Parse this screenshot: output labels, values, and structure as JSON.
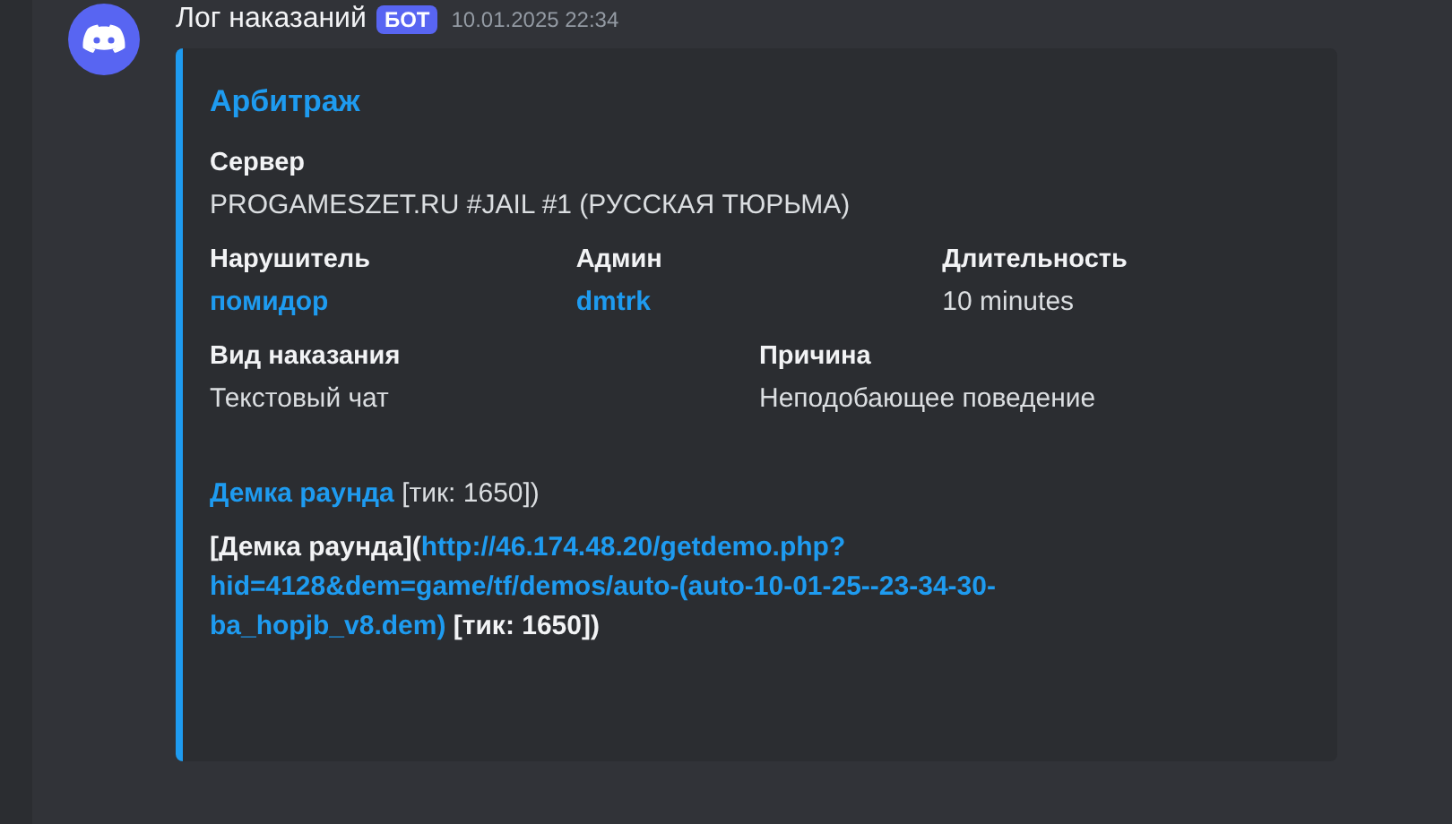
{
  "message": {
    "author": "Лог наказаний",
    "badge": "БОТ",
    "timestamp": "10.01.2025 22:34"
  },
  "embed": {
    "title": "Арбитраж",
    "field_rows": [
      {
        "fields": [
          {
            "name": "Сервер",
            "value": "PROGAMESZET.RU #JAIL #1 (РУССКАЯ ТЮРЬМА)",
            "kind": "text"
          }
        ]
      },
      {
        "fields": [
          {
            "name": "Нарушитель",
            "value": "помидор",
            "kind": "mention"
          },
          {
            "name": "Админ",
            "value": "dmtrk",
            "kind": "mention"
          },
          {
            "name": "Длительность",
            "value": "10 minutes",
            "kind": "text"
          }
        ]
      },
      {
        "fields": [
          {
            "name": "Вид наказания",
            "value": "Текстовый чат",
            "kind": "text"
          },
          {
            "name": "Причина",
            "value": "Неподобающее поведение",
            "kind": "text"
          }
        ]
      }
    ],
    "paragraphs": [
      {
        "bold": false,
        "parts": [
          {
            "kind": "link",
            "text": "Демка раунда"
          },
          {
            "kind": "text",
            "text": " [тик: 1650])"
          }
        ]
      },
      {
        "bold": true,
        "parts": [
          {
            "kind": "text",
            "text": "[Демка раунда]("
          },
          {
            "kind": "link",
            "text": "http://46.174.48.20/getdemo.php?hid=4128&dem=game/tf/demos/auto-(auto-10-01-25--23-34-30-ba_hopjb_v8.dem)"
          },
          {
            "kind": "text",
            "text": " [тик: 1650])"
          }
        ]
      }
    ]
  }
}
